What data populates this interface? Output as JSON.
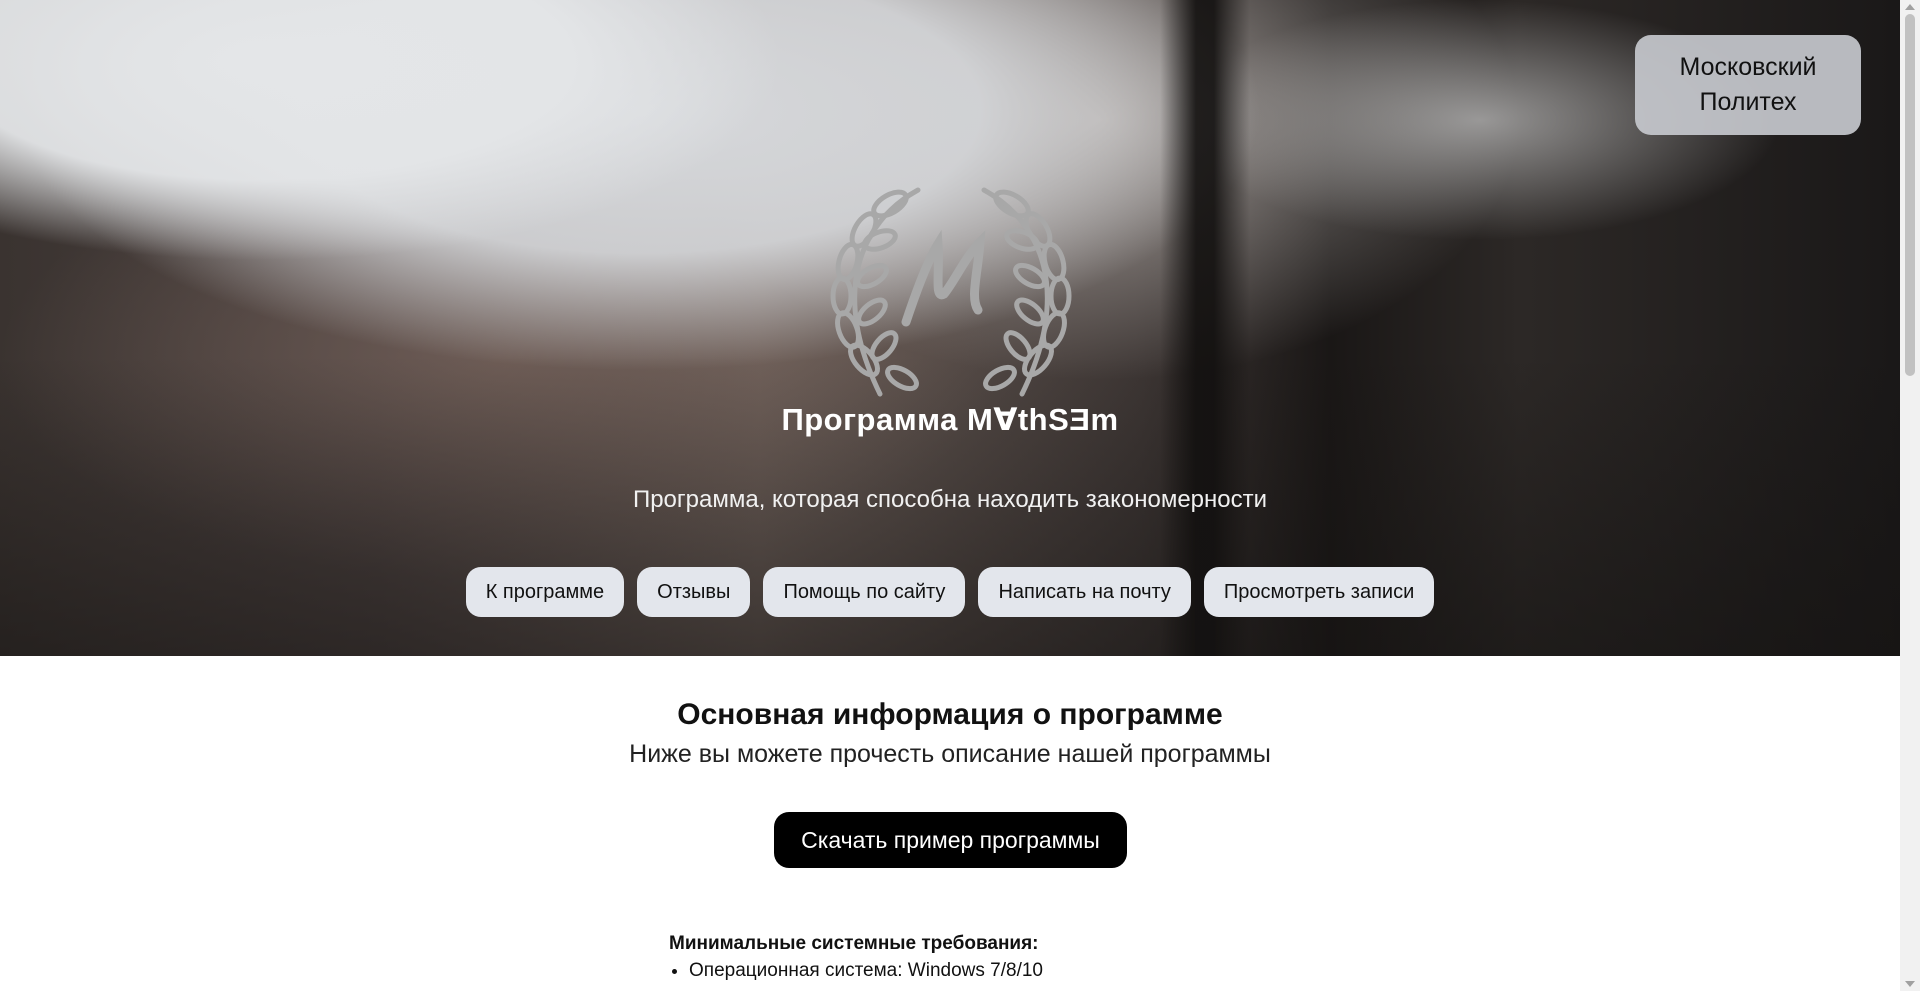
{
  "header": {
    "university_badge": "Московский Политех",
    "logo_icon": "laurel-wreath-m-logo",
    "title": "Программа M∀thSƎm",
    "subtitle": "Программа, которая способна находить закономерности"
  },
  "nav": {
    "items": [
      {
        "label": "К программе"
      },
      {
        "label": "Отзывы"
      },
      {
        "label": "Помощь по сайту"
      },
      {
        "label": "Написать на почту"
      },
      {
        "label": "Просмотреть записи"
      }
    ]
  },
  "main": {
    "section_title": "Основная информация о программе",
    "section_subtitle": "Ниже вы можете прочесть описание нашей программы",
    "download_label": "Скачать пример программы",
    "requirements": {
      "heading": "Минимальные системные требования:",
      "items": [
        "Операционная система: Windows 7/8/10"
      ]
    }
  },
  "colors": {
    "nav_button_bg": "#e3e6ec",
    "download_button_bg": "#000000",
    "badge_bg": "#c6c8cd",
    "logo_stroke": "#a8a8a8"
  }
}
